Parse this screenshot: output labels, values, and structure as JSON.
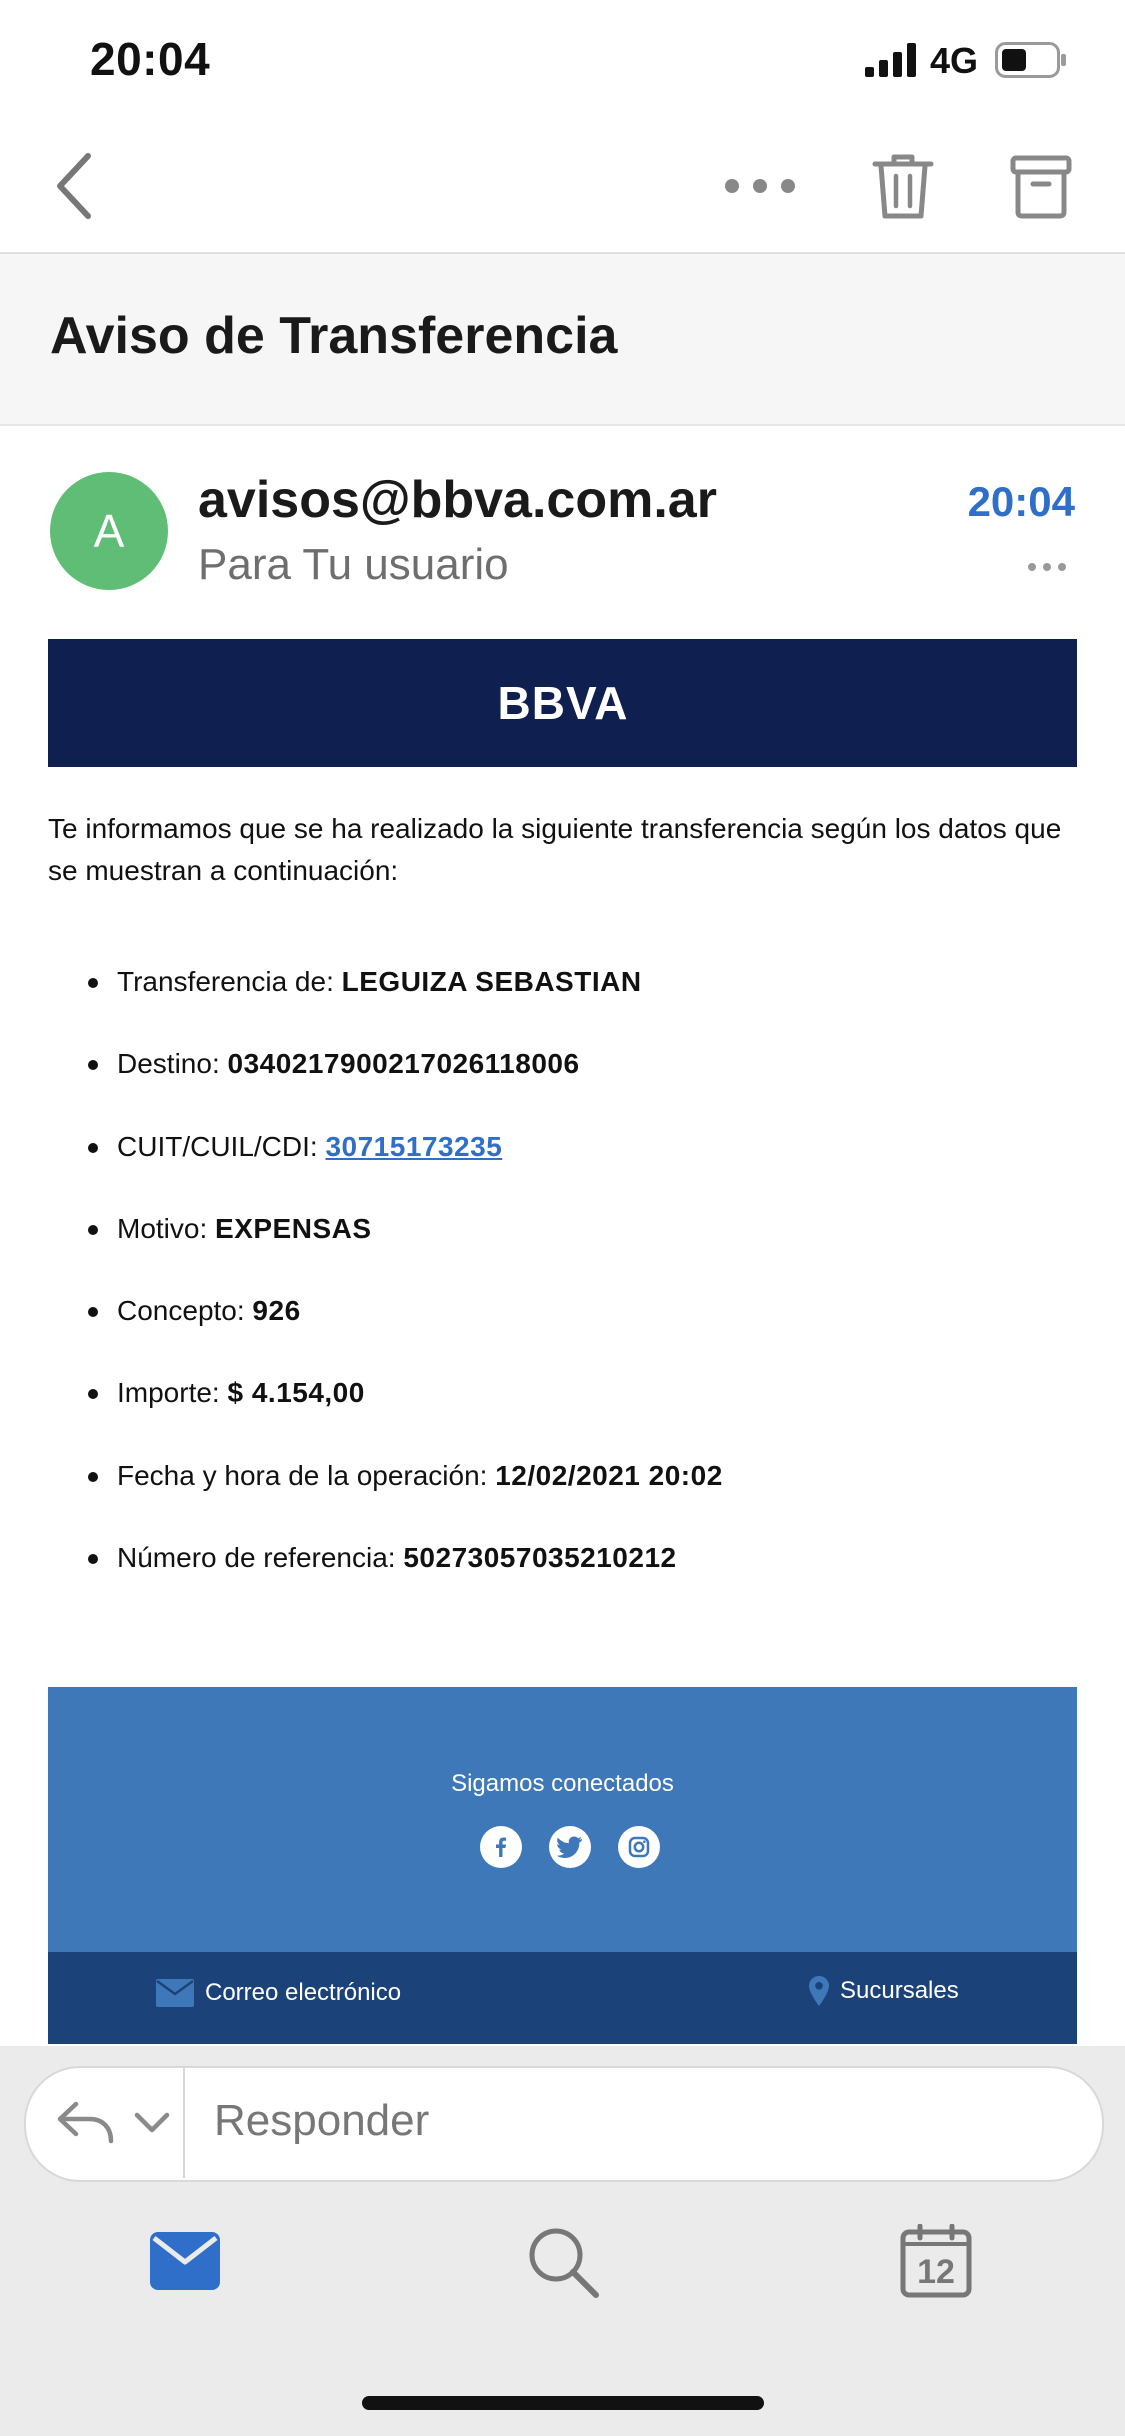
{
  "status_bar": {
    "time": "20:04",
    "network": "4G"
  },
  "nav": {
    "back": "back",
    "more": "more",
    "trash": "delete",
    "archive": "archive"
  },
  "subject": "Aviso de Transferencia",
  "sender": {
    "avatar_initial": "A",
    "email": "avisos@bbva.com.ar",
    "recipient_line": "Para Tu usuario",
    "time": "20:04"
  },
  "email_body": {
    "logo_text": "BBVA",
    "intro": "Te informamos que se ha realizado la siguiente transferencia según los datos que se muestran a continuación:",
    "details": [
      {
        "label": "Transferencia de:",
        "value": "LEGUIZA SEBASTIAN"
      },
      {
        "label": "Destino:",
        "value": "0340217900217026118006"
      },
      {
        "label": "CUIT/CUIL/CDI:",
        "value": "30715173235"
      },
      {
        "label": "Motivo:",
        "value": "EXPENSAS"
      },
      {
        "label": "Concepto:",
        "value": "926"
      },
      {
        "label": "Importe:",
        "value": "$ 4.154,00"
      },
      {
        "label": "Fecha y hora de la operación:",
        "value": "12/02/2021 20:02"
      },
      {
        "label": "Número de referencia:",
        "value": "50273057035210212"
      }
    ],
    "footer": {
      "social_caption": "Sigamos conectados",
      "mail_link": "Correo electrónico",
      "branches_link": "Sucursales"
    }
  },
  "reply": {
    "placeholder": "Responder"
  },
  "tab_bar": {
    "calendar_day": "12"
  },
  "colors": {
    "accent": "#2f6fc9",
    "avatar": "#5fbd75",
    "bbva_navy": "#0f2050",
    "footer_blue": "#3f78b8",
    "footer_dark": "#1c427a"
  }
}
